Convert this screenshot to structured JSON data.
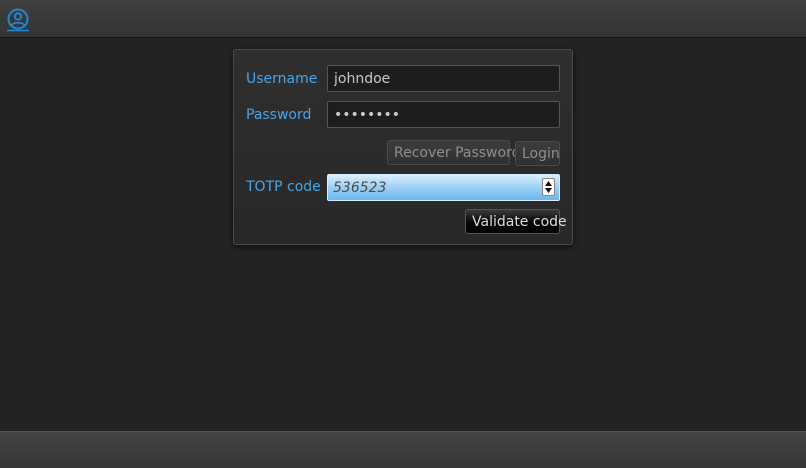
{
  "topbar": {
    "user_icon": "user-circle-icon",
    "accent_color": "#1e8ad6"
  },
  "login_panel": {
    "username_label": "Username",
    "username_value": "johndoe",
    "password_label": "Password",
    "password_value": "secret12",
    "recover_password_label": "Recover Password",
    "login_label": "Login",
    "totp_label": "TOTP code",
    "totp_value": "536523",
    "validate_label": "Validate code",
    "label_color": "#49a6e8"
  }
}
